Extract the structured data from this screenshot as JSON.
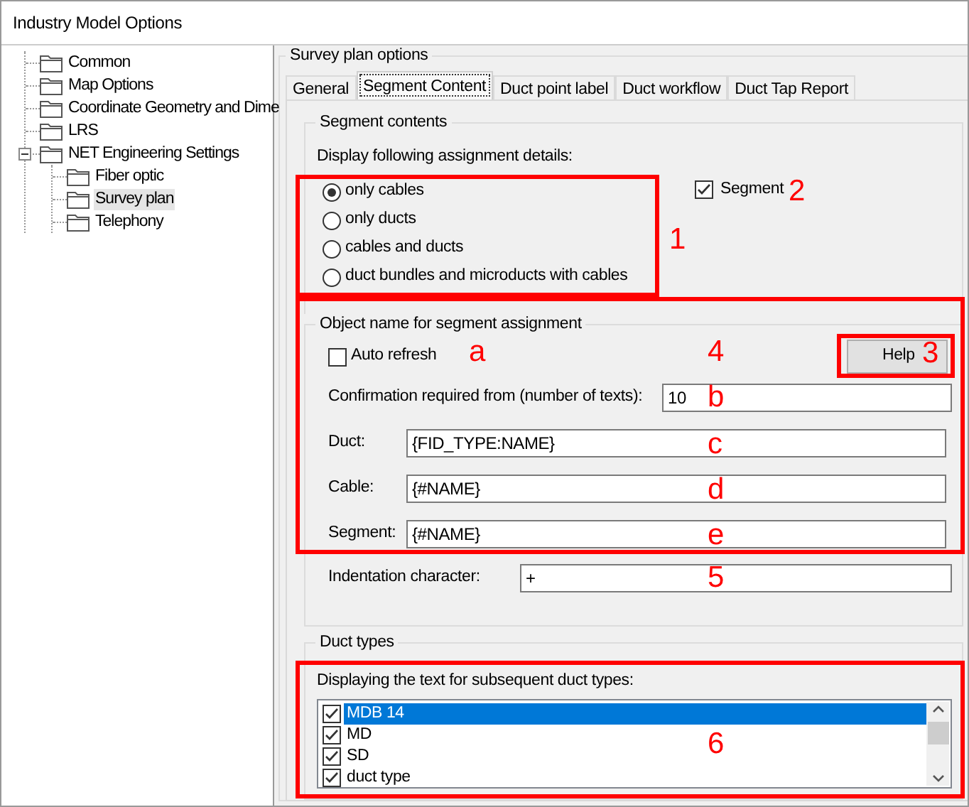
{
  "window": {
    "title": "Industry Model Options"
  },
  "tree": [
    {
      "label": "Common",
      "selected": false
    },
    {
      "label": "Map Options",
      "selected": false
    },
    {
      "label": "Coordinate Geometry and Dime",
      "selected": false
    },
    {
      "label": "LRS",
      "selected": false
    },
    {
      "label": "NET Engineering Settings",
      "selected": false,
      "expanded": true,
      "children": [
        {
          "label": "Fiber optic",
          "selected": false
        },
        {
          "label": "Survey plan",
          "selected": true
        },
        {
          "label": "Telephony",
          "selected": false
        }
      ]
    }
  ],
  "panel": {
    "title": "Survey plan options",
    "tabs": [
      {
        "label": "General",
        "selected": false
      },
      {
        "label": "Segment Content",
        "selected": true
      },
      {
        "label": "Duct point label",
        "selected": false
      },
      {
        "label": "Duct workflow",
        "selected": false
      },
      {
        "label": "Duct Tap Report",
        "selected": false
      }
    ],
    "segment_contents": {
      "title": "Segment contents",
      "prompt": "Display following assignment details:",
      "options": [
        {
          "label": "only cables",
          "selected": true
        },
        {
          "label": "only ducts",
          "selected": false
        },
        {
          "label": "cables and ducts",
          "selected": false
        },
        {
          "label": "duct bundles and microducts with cables",
          "selected": false
        }
      ],
      "segment_checkbox": {
        "label": "Segment",
        "checked": true
      }
    },
    "object_name": {
      "title": "Object name for segment assignment",
      "auto_refresh": {
        "label": "Auto refresh",
        "checked": false
      },
      "help_button": "Help",
      "fields": [
        {
          "label": "Confirmation required from (number of texts):",
          "value": "10"
        },
        {
          "label": "Duct:",
          "value": "{FID_TYPE:NAME}"
        },
        {
          "label": "Cable:",
          "value": "{#NAME}"
        },
        {
          "label": "Segment:",
          "value": "{#NAME}"
        }
      ],
      "indentation": {
        "label": "Indentation character:",
        "value": "+"
      }
    },
    "duct_types": {
      "title": "Duct types",
      "prompt": "Displaying the text for subsequent duct types:",
      "items": [
        {
          "label": "MDB 14",
          "checked": true,
          "selected": true
        },
        {
          "label": "MD",
          "checked": true,
          "selected": false
        },
        {
          "label": "SD",
          "checked": true,
          "selected": false
        },
        {
          "label": "duct type",
          "checked": true,
          "selected": false
        }
      ]
    }
  },
  "annotations": [
    {
      "label": "1"
    },
    {
      "label": "2"
    },
    {
      "label": "a"
    },
    {
      "label": "4"
    },
    {
      "label": "3"
    },
    {
      "label": "b"
    },
    {
      "label": "c"
    },
    {
      "label": "d"
    },
    {
      "label": "e"
    },
    {
      "label": "5"
    },
    {
      "label": "6"
    }
  ]
}
